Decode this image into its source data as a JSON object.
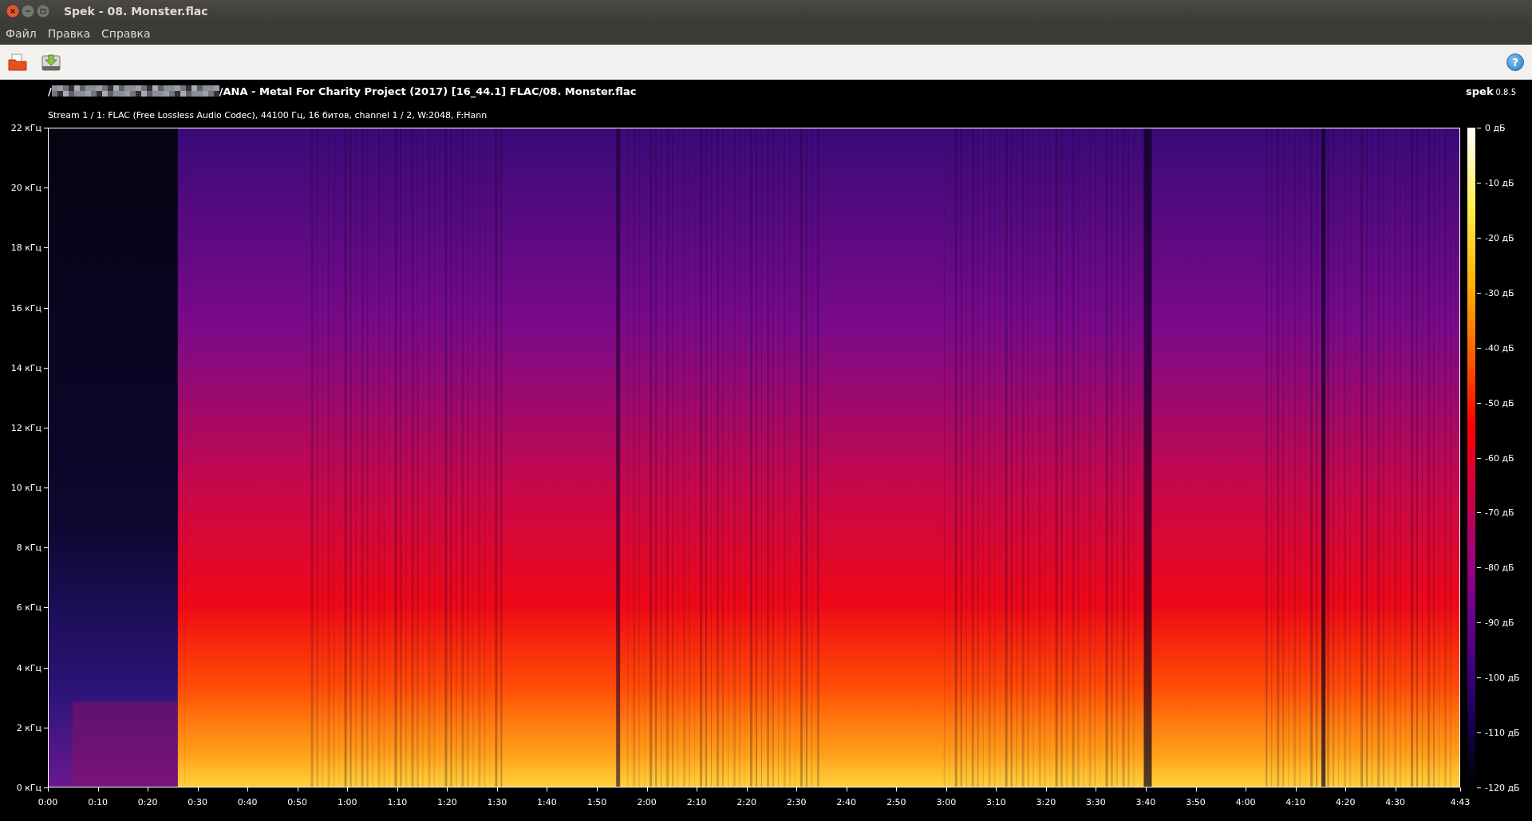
{
  "window": {
    "title": "Spek - 08. Monster.flac"
  },
  "menu": [
    "Файл",
    "Правка",
    "Справка"
  ],
  "toolbar": {
    "help_button": "?"
  },
  "file_info": {
    "path_start": "/",
    "path_end": "/ANA - Metal For Charity Project (2017) [16_44.1] FLAC/08. Monster.flac",
    "stream": "Stream 1 / 1: FLAC (Free Lossless Audio Codec), 44100 Гц, 16 битов, channel 1 / 2, W:2048, F:Hann"
  },
  "branding": {
    "name": "spek",
    "version": "0.8.5"
  },
  "frequency_axis": [
    "22 кГц",
    "20 кГц",
    "18 кГц",
    "16 кГц",
    "14 кГц",
    "12 кГц",
    "10 кГц",
    "8 кГц",
    "6 кГц",
    "4 кГц",
    "2 кГц",
    "0 кГц"
  ],
  "time_axis": [
    "0:00",
    "0:10",
    "0:20",
    "0:30",
    "0:40",
    "0:50",
    "1:00",
    "1:10",
    "1:20",
    "1:30",
    "1:40",
    "1:50",
    "2:00",
    "2:10",
    "2:20",
    "2:30",
    "2:40",
    "2:50",
    "3:00",
    "3:10",
    "3:20",
    "3:30",
    "3:40",
    "3:50",
    "4:00",
    "4:10",
    "4:20",
    "4:30",
    "4:43"
  ],
  "level_axis": [
    "0 дБ",
    "-10 дБ",
    "-20 дБ",
    "-30 дБ",
    "-40 дБ",
    "-50 дБ",
    "-60 дБ",
    "-70 дБ",
    "-80 дБ",
    "-90 дБ",
    "-100 дБ",
    "-110 дБ",
    "-120 дБ"
  ]
}
